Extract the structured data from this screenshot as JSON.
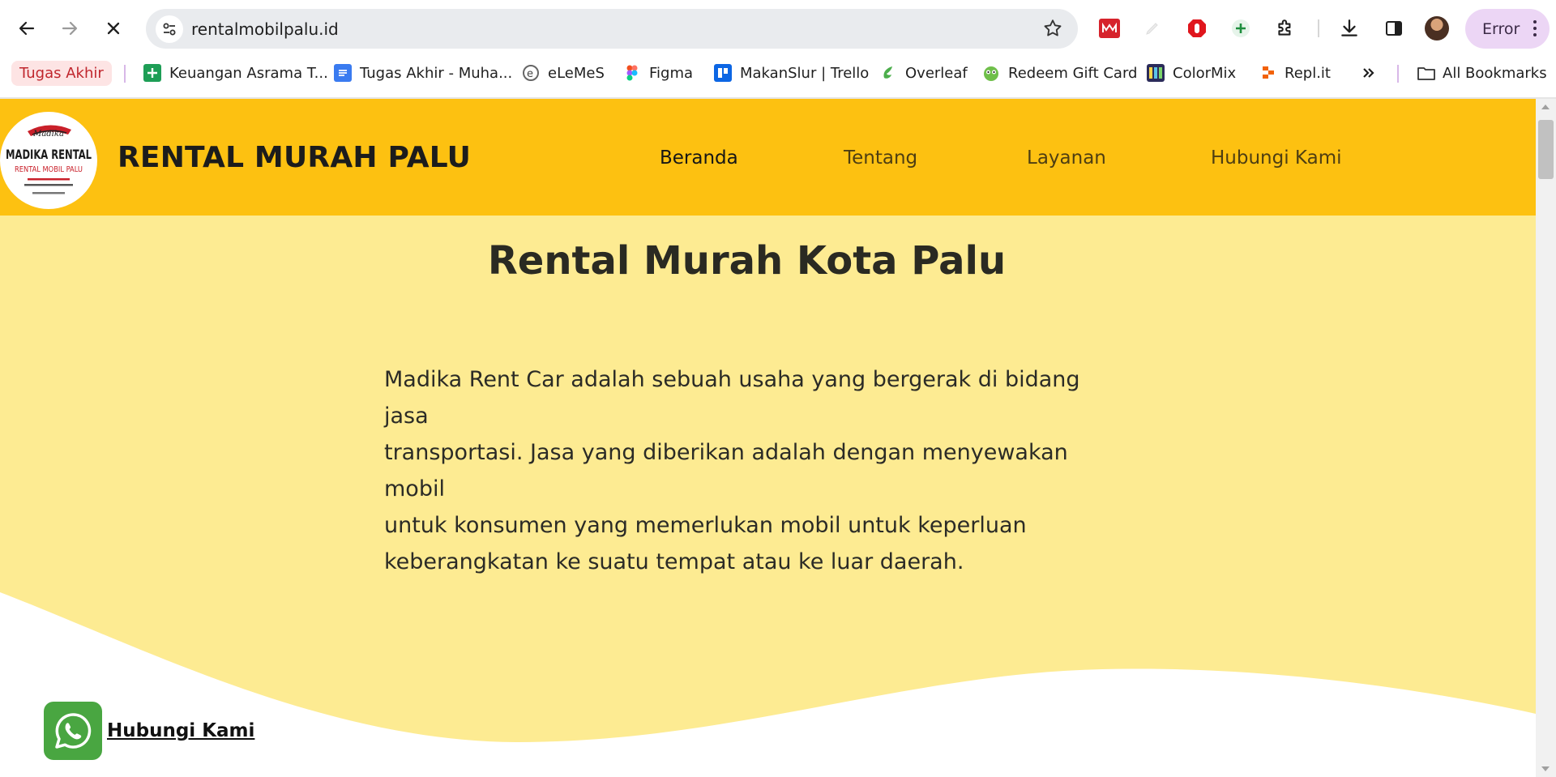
{
  "browser": {
    "url": "rentalmobilpalu.id",
    "profile_status": "Error",
    "bookmarks": [
      {
        "label": "Tugas Akhir",
        "icon": "folder-chip"
      },
      {
        "label": "Keuangan Asrama T...",
        "icon": "google-sheets-icon"
      },
      {
        "label": "Tugas Akhir - Muha...",
        "icon": "google-docs-icon"
      },
      {
        "label": "eLeMeS",
        "icon": "elemes-icon"
      },
      {
        "label": "Figma",
        "icon": "figma-icon"
      },
      {
        "label": "MakanSlur | Trello",
        "icon": "trello-icon"
      },
      {
        "label": "Overleaf",
        "icon": "overleaf-icon"
      },
      {
        "label": "Redeem Gift Card",
        "icon": "gift-card-icon"
      },
      {
        "label": "ColorMix",
        "icon": "colormix-icon"
      },
      {
        "label": "Repl.it",
        "icon": "replit-icon"
      }
    ],
    "all_bookmarks": "All Bookmarks",
    "colors": {
      "error_chip": "#ecd6f5",
      "tab_accent": "#c0262d"
    }
  },
  "site": {
    "title": "RENTAL MURAH PALU",
    "logo": {
      "brand_script": "Madika",
      "brand_name": "MADIKA RENTAL",
      "tagline": "RENTAL MOBIL PALU"
    },
    "nav": [
      "Beranda",
      "Tentang",
      "Layanan",
      "Hubungi Kami"
    ],
    "active_nav": "Beranda",
    "colors": {
      "header": "#fdc111",
      "hero": "#fdeb92"
    }
  },
  "hero": {
    "title": "Rental Murah Kota Palu",
    "lines": [
      "Madika Rent Car adalah sebuah usaha yang bergerak di bidang jasa",
      "transportasi. Jasa yang diberikan adalah dengan menyewakan mobil",
      "untuk konsumen yang memerlukan mobil untuk keperluan",
      "keberangkatan ke suatu tempat atau ke luar daerah."
    ]
  },
  "whatsapp": {
    "label": "Hubungi Kami",
    "icon": "whatsapp-icon",
    "color": "#49a641"
  }
}
